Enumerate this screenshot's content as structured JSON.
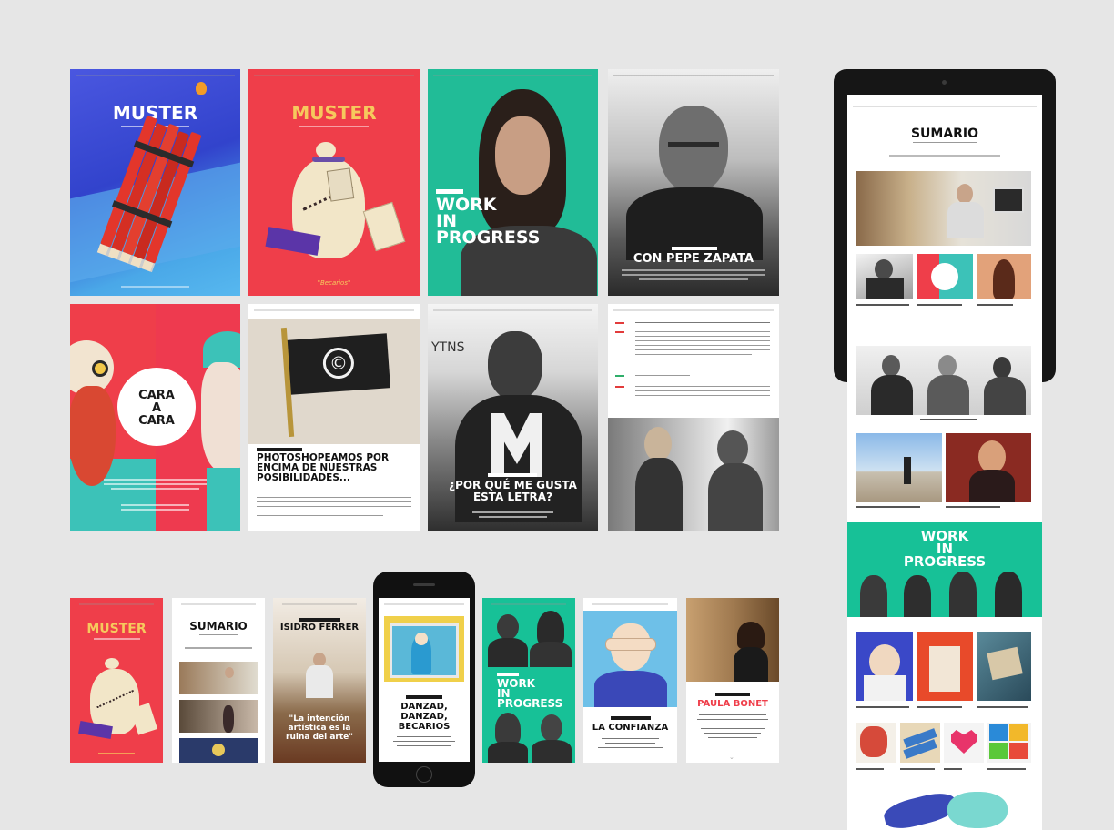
{
  "colors": {
    "background": "#e6e6e6",
    "muster_blue": "#3b48d6",
    "muster_red": "#ef3e4a",
    "teal": "#17c197",
    "yellow": "#f6c95d",
    "dark": "#1a1a1a"
  },
  "row1": {
    "cover_blue": {
      "title": "MUSTER"
    },
    "cover_red": {
      "title": "MUSTER",
      "quote": "\"Becarios\""
    },
    "work_in_progress": {
      "line1": "WORK",
      "line2": "IN",
      "line3": "PROGRESS"
    },
    "pepe_zapata": {
      "title": "CON PEPE ZAPATA"
    }
  },
  "row2": {
    "cara_a_cara": {
      "line1": "CARA",
      "line2": "A",
      "line3": "CARA"
    },
    "photoshop": {
      "title": "PHOTOSHOPEAMOS POR ENCIMA DE NUESTRAS POSIBILIDADES..."
    },
    "letra": {
      "title": "¿POR QUÉ ME GUSTA ESTA LETRA?",
      "sign": "YTNS"
    },
    "interview": {}
  },
  "tablet": {
    "title": "SUMARIO",
    "wip": {
      "line1": "WORK",
      "line2": "IN",
      "line3": "PROGRESS"
    }
  },
  "row3": {
    "muster_small": {
      "title": "MUSTER"
    },
    "sumario_small": {
      "title": "SUMARIO"
    },
    "isidro": {
      "title": "ISIDRO FERRER",
      "quote": "\"La intención artística es la ruina del arte\""
    },
    "phone": {
      "title": "DANZAD, DANZAD, BECARIOS"
    },
    "wip_small": {
      "line1": "WORK",
      "line2": "IN",
      "line3": "PROGRESS"
    },
    "confianza": {
      "title": "LA CONFIANZA"
    },
    "paula": {
      "title": "PAULA BONET"
    }
  }
}
